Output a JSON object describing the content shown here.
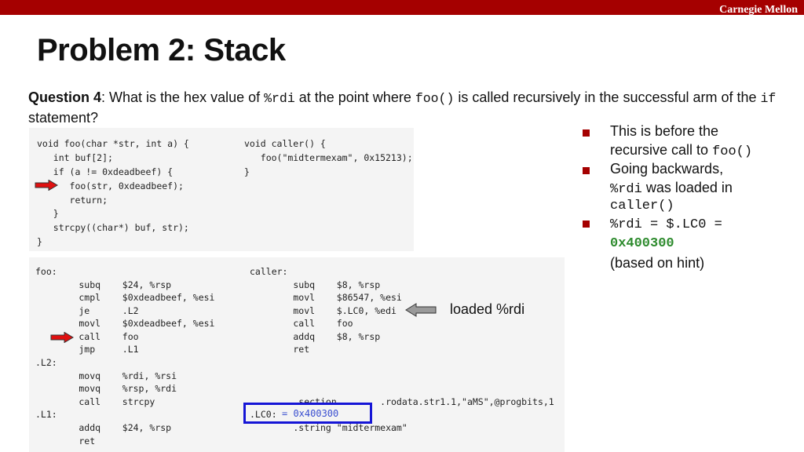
{
  "header": {
    "brand": "Carnegie Mellon"
  },
  "title": "Problem 2: Stack",
  "question": {
    "label": "Question 4",
    "text1": ": What is the hex value of ",
    "code1": "%rdi",
    "text2": " at the point where ",
    "code2": "foo()",
    "text3": " is called recursively in the successful arm of the ",
    "code3": "if",
    "text4": " statement?"
  },
  "c_code": {
    "foo_lines": [
      "void foo(char *str, int a) {",
      "   int buf[2];",
      "   if (a != 0xdeadbeef) {",
      "      foo(str, 0xdeadbeef);",
      "      return;",
      "   }",
      "   strcpy((char*) buf, str);",
      "}"
    ],
    "caller_lines": [
      "void caller() {",
      "   foo(\"midtermexam\", 0x15213);",
      "}"
    ]
  },
  "asm": {
    "foo_lines": [
      "foo:",
      "        subq    $24, %rsp",
      "        cmpl    $0xdeadbeef, %esi",
      "        je      .L2",
      "        movl    $0xdeadbeef, %esi",
      "        call    foo",
      "        jmp     .L1",
      ".L2:",
      "        movq    %rdi, %rsi",
      "        movq    %rsp, %rdi",
      "        call    strcpy",
      ".L1:",
      "        addq    $24, %rsp",
      "        ret"
    ],
    "caller_lines": [
      "caller:",
      "        subq    $8, %rsp",
      "        movl    $86547, %esi",
      "        movl    $.LC0, %edi",
      "        call    foo",
      "        addq    $8, %rsp",
      "        ret"
    ],
    "section_line": "        .section        .rodata.str1.1,\"aMS\",@progbits,1",
    "lc0_label": ".LC0:",
    "lc0_value": "= 0x400300",
    "string_line": "        .string \"midtermexam\""
  },
  "annotation": {
    "loaded_label": "loaded %rdi"
  },
  "bullets": {
    "b1_line1": "This is before the",
    "b1_line2": "recursive call to ",
    "b1_code": "foo()",
    "b2_line1": "Going backwards,",
    "b2_code1": "%rdi",
    "b2_text": " was loaded in",
    "b2_code2": "caller()",
    "b3_code": "%rdi = $.LC0 =",
    "b3_value": "0x400300",
    "b3_note": "(based on hint)"
  },
  "colors": {
    "accent": "#a50000",
    "highlight": "#1515d6",
    "answer": "#2e8b2e"
  }
}
